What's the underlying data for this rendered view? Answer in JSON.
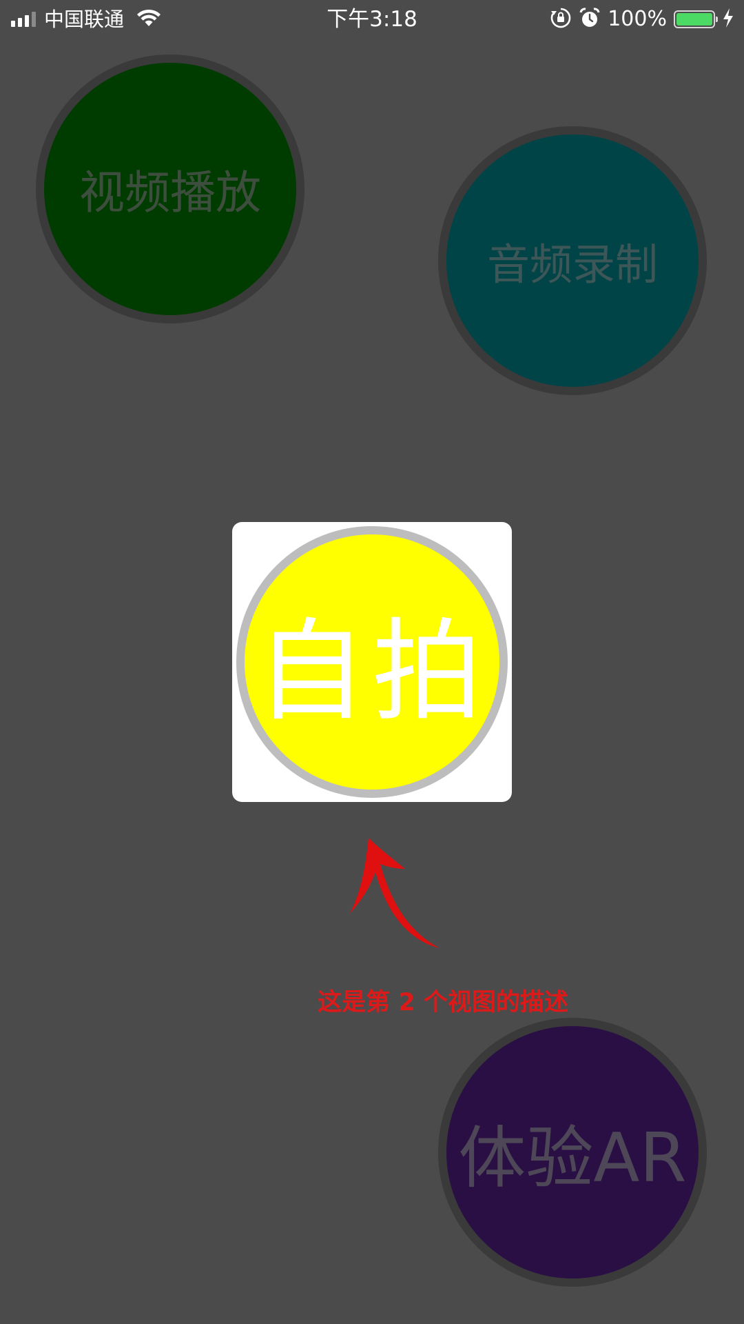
{
  "status_bar": {
    "carrier": "中国联通",
    "time": "下午3:18",
    "battery_percent": "100%",
    "battery_level": 1.0,
    "icons": [
      "signal-icon",
      "wifi-icon",
      "orientation-lock-icon",
      "alarm-icon",
      "battery-icon",
      "charging-icon"
    ]
  },
  "buttons": {
    "video_play": "视频播放",
    "audio_record": "音频录制",
    "selfie": "自拍",
    "experience_ar": "体验AR"
  },
  "guide": {
    "hint": "这是第 2 个视图的描述"
  },
  "colors": {
    "background": "#4b4b4b",
    "video_circle": "#003c00",
    "audio_circle": "#004447",
    "selfie_circle": "#ffff00",
    "ar_circle": "#2a0f44",
    "hint_red": "#dc1a1a",
    "battery_green": "#4cd964"
  }
}
